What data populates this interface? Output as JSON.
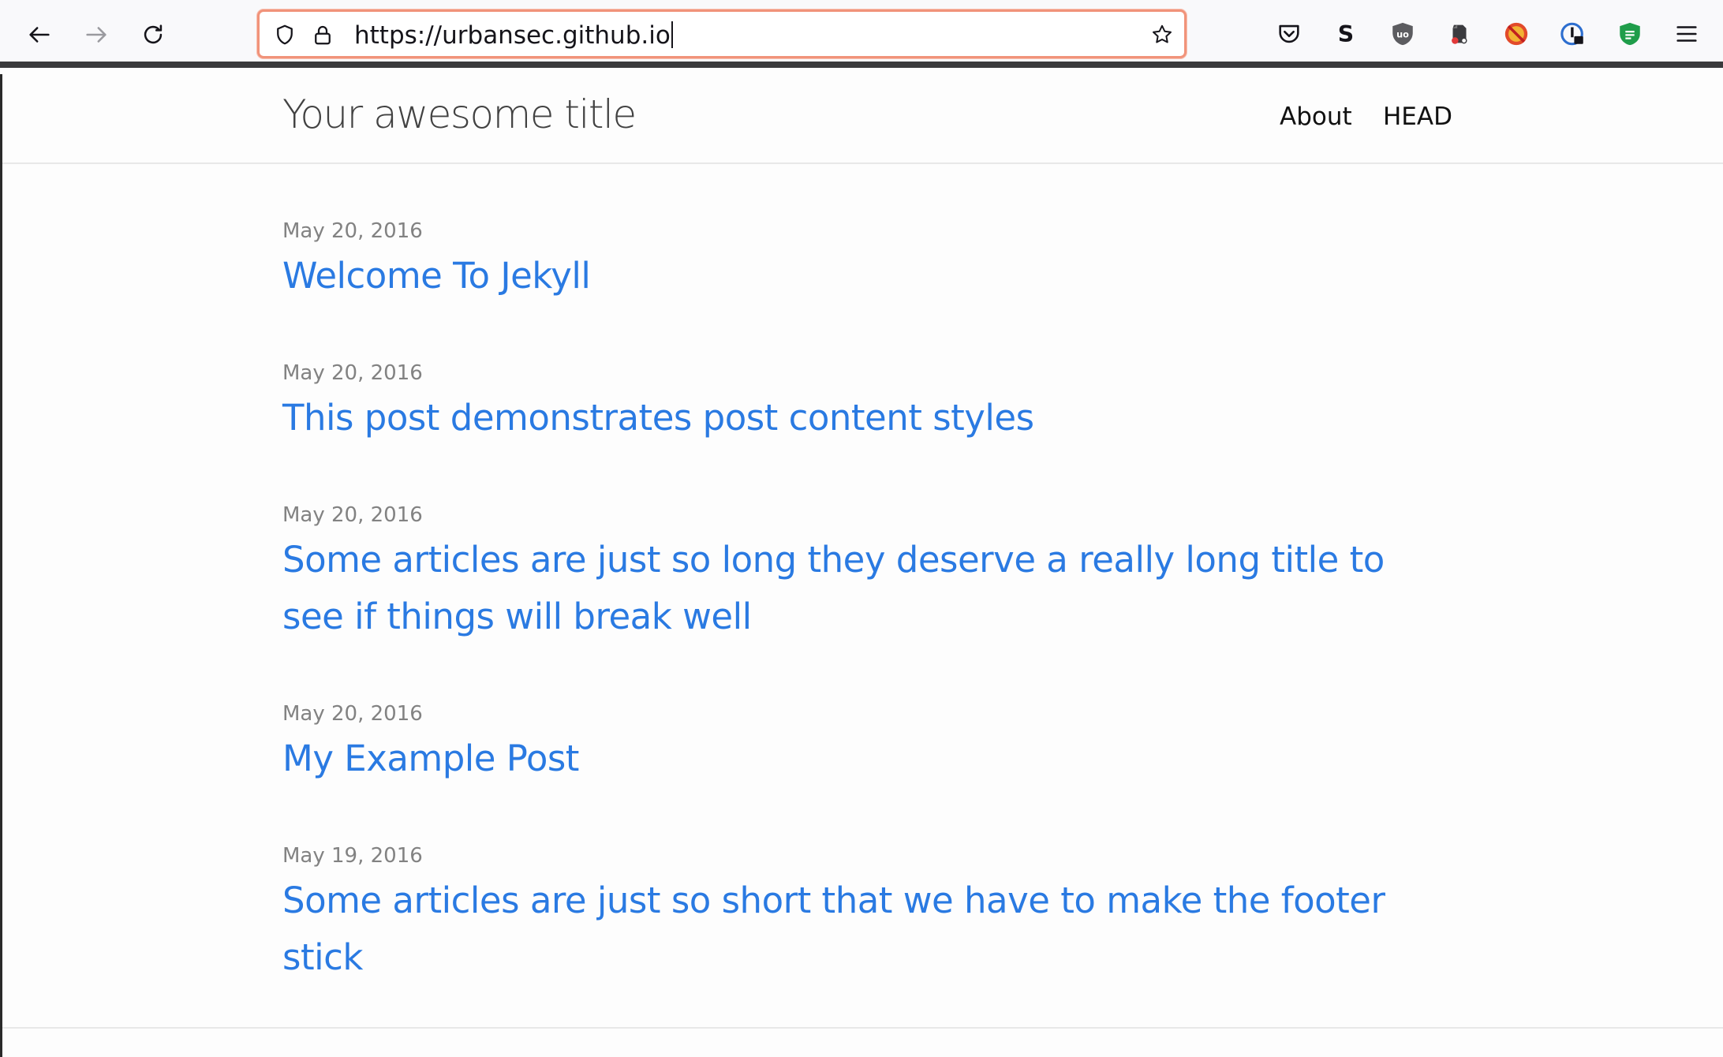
{
  "browser": {
    "url": "https://urbansec.github.io",
    "back_icon": "back-arrow-icon",
    "forward_icon": "forward-arrow-icon",
    "reload_icon": "reload-icon",
    "extensions": [
      "pocket-icon",
      "s-extension-icon",
      "ublock-icon",
      "evernote-icon",
      "blocked-extension-icon",
      "password-extension-icon",
      "green-shield-extension-icon",
      "menu-icon"
    ]
  },
  "site": {
    "title": "Your awesome title",
    "nav": [
      {
        "label": "About"
      },
      {
        "label": "HEAD"
      }
    ]
  },
  "posts": [
    {
      "date": "May 20, 2016",
      "title": "Welcome To Jekyll"
    },
    {
      "date": "May 20, 2016",
      "title": "This post demonstrates post content styles"
    },
    {
      "date": "May 20, 2016",
      "title": "Some articles are just so long they deserve a really long title to see if things will break well"
    },
    {
      "date": "May 20, 2016",
      "title": "My Example Post"
    },
    {
      "date": "May 19, 2016",
      "title": "Some articles are just so short that we have to make the footer stick"
    }
  ],
  "colors": {
    "link": "#2a7ae2",
    "date": "#828282",
    "urlbar_focus": "#f1937a"
  }
}
